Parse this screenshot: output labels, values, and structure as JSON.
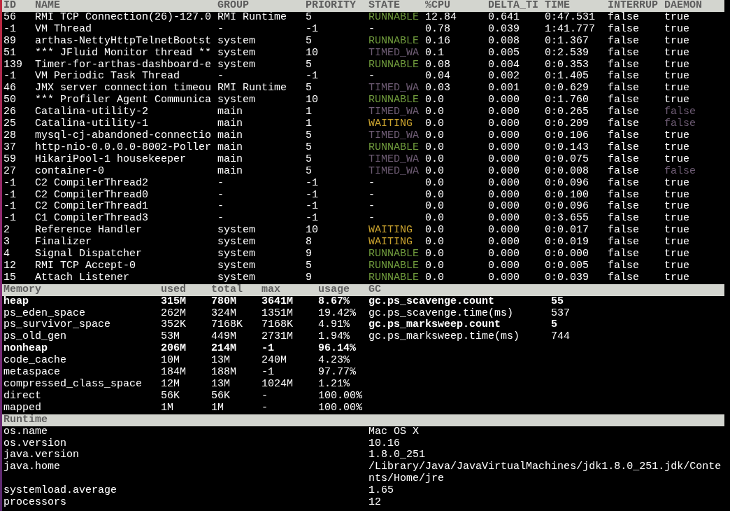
{
  "threads": {
    "columns": [
      "ID",
      "NAME",
      "GROUP",
      "PRIORITY",
      "STATE",
      "%CPU",
      "DELTA_TI",
      "TIME",
      "INTERRUP",
      "DAEMON"
    ],
    "rows": [
      {
        "id": "56",
        "name": "RMI TCP Connection(26)-127.0",
        "group": "RMI Runtime",
        "priority": "5",
        "state": {
          "text": "RUNNABLE",
          "color": "#6f9a3c"
        },
        "cpu": "12.84",
        "delta": "0.641",
        "time": "0:47.531",
        "interrupted": "false",
        "daemon": {
          "text": "true",
          "color": "#ffffff"
        }
      },
      {
        "id": "-1",
        "name": "VM Thread",
        "group": "-",
        "priority": "-1",
        "state": {
          "text": "-",
          "color": "#ffffff"
        },
        "cpu": "0.78",
        "delta": "0.039",
        "time": "1:41.777",
        "interrupted": "false",
        "daemon": {
          "text": "true",
          "color": "#ffffff"
        }
      },
      {
        "id": "89",
        "name": "arthas-NettyHttpTelnetBootst",
        "group": "system",
        "priority": "5",
        "state": {
          "text": "RUNNABLE",
          "color": "#6f9a3c"
        },
        "cpu": "0.16",
        "delta": "0.008",
        "time": "0:1.367",
        "interrupted": "false",
        "daemon": {
          "text": "true",
          "color": "#ffffff"
        }
      },
      {
        "id": "51",
        "name": "*** JFluid Monitor thread **",
        "group": "system",
        "priority": "10",
        "state": {
          "text": "TIMED_WA",
          "color": "#6e5c74"
        },
        "cpu": "0.1",
        "delta": "0.005",
        "time": "0:2.539",
        "interrupted": "false",
        "daemon": {
          "text": "true",
          "color": "#ffffff"
        }
      },
      {
        "id": "139",
        "name": "Timer-for-arthas-dashboard-e",
        "group": "system",
        "priority": "5",
        "state": {
          "text": "RUNNABLE",
          "color": "#6f9a3c"
        },
        "cpu": "0.08",
        "delta": "0.004",
        "time": "0:0.353",
        "interrupted": "false",
        "daemon": {
          "text": "true",
          "color": "#ffffff"
        }
      },
      {
        "id": "-1",
        "name": "VM Periodic Task Thread",
        "group": "-",
        "priority": "-1",
        "state": {
          "text": "-",
          "color": "#ffffff"
        },
        "cpu": "0.04",
        "delta": "0.002",
        "time": "0:1.405",
        "interrupted": "false",
        "daemon": {
          "text": "true",
          "color": "#ffffff"
        }
      },
      {
        "id": "46",
        "name": "JMX server connection timeou",
        "group": "RMI Runtime",
        "priority": "5",
        "state": {
          "text": "TIMED_WA",
          "color": "#6e5c74"
        },
        "cpu": "0.03",
        "delta": "0.001",
        "time": "0:0.629",
        "interrupted": "false",
        "daemon": {
          "text": "true",
          "color": "#ffffff"
        }
      },
      {
        "id": "50",
        "name": "*** Profiler Agent Communica",
        "group": "system",
        "priority": "10",
        "state": {
          "text": "RUNNABLE",
          "color": "#6f9a3c"
        },
        "cpu": "0.0",
        "delta": "0.000",
        "time": "0:1.760",
        "interrupted": "false",
        "daemon": {
          "text": "true",
          "color": "#ffffff"
        }
      },
      {
        "id": "26",
        "name": "Catalina-utility-2",
        "group": "main",
        "priority": "1",
        "state": {
          "text": "TIMED_WA",
          "color": "#6e5c74"
        },
        "cpu": "0.0",
        "delta": "0.000",
        "time": "0:0.265",
        "interrupted": "false",
        "daemon": {
          "text": "false",
          "color": "#6e5c74"
        }
      },
      {
        "id": "25",
        "name": "Catalina-utility-1",
        "group": "main",
        "priority": "1",
        "state": {
          "text": "WAITING",
          "color": "#c9a22e"
        },
        "cpu": "0.0",
        "delta": "0.000",
        "time": "0:0.209",
        "interrupted": "false",
        "daemon": {
          "text": "false",
          "color": "#6e5c74"
        }
      },
      {
        "id": "28",
        "name": "mysql-cj-abandoned-connectio",
        "group": "main",
        "priority": "5",
        "state": {
          "text": "TIMED_WA",
          "color": "#6e5c74"
        },
        "cpu": "0.0",
        "delta": "0.000",
        "time": "0:0.106",
        "interrupted": "false",
        "daemon": {
          "text": "true",
          "color": "#ffffff"
        }
      },
      {
        "id": "37",
        "name": "http-nio-0.0.0.0-8002-Poller",
        "group": "main",
        "priority": "5",
        "state": {
          "text": "RUNNABLE",
          "color": "#6f9a3c"
        },
        "cpu": "0.0",
        "delta": "0.000",
        "time": "0:0.143",
        "interrupted": "false",
        "daemon": {
          "text": "true",
          "color": "#ffffff"
        }
      },
      {
        "id": "59",
        "name": "HikariPool-1 housekeeper",
        "group": "main",
        "priority": "5",
        "state": {
          "text": "TIMED_WA",
          "color": "#6e5c74"
        },
        "cpu": "0.0",
        "delta": "0.000",
        "time": "0:0.075",
        "interrupted": "false",
        "daemon": {
          "text": "true",
          "color": "#ffffff"
        }
      },
      {
        "id": "27",
        "name": "container-0",
        "group": "main",
        "priority": "5",
        "state": {
          "text": "TIMED_WA",
          "color": "#6e5c74"
        },
        "cpu": "0.0",
        "delta": "0.000",
        "time": "0:0.008",
        "interrupted": "false",
        "daemon": {
          "text": "false",
          "color": "#6e5c74"
        }
      },
      {
        "id": "-1",
        "name": "C2 CompilerThread2",
        "group": "-",
        "priority": "-1",
        "state": {
          "text": "-",
          "color": "#ffffff"
        },
        "cpu": "0.0",
        "delta": "0.000",
        "time": "0:0.096",
        "interrupted": "false",
        "daemon": {
          "text": "true",
          "color": "#ffffff"
        }
      },
      {
        "id": "-1",
        "name": "C2 CompilerThread0",
        "group": "-",
        "priority": "-1",
        "state": {
          "text": "-",
          "color": "#ffffff"
        },
        "cpu": "0.0",
        "delta": "0.000",
        "time": "0:0.100",
        "interrupted": "false",
        "daemon": {
          "text": "true",
          "color": "#ffffff"
        }
      },
      {
        "id": "-1",
        "name": "C2 CompilerThread1",
        "group": "-",
        "priority": "-1",
        "state": {
          "text": "-",
          "color": "#ffffff"
        },
        "cpu": "0.0",
        "delta": "0.000",
        "time": "0:0.096",
        "interrupted": "false",
        "daemon": {
          "text": "true",
          "color": "#ffffff"
        }
      },
      {
        "id": "-1",
        "name": "C1 CompilerThread3",
        "group": "-",
        "priority": "-1",
        "state": {
          "text": "-",
          "color": "#ffffff"
        },
        "cpu": "0.0",
        "delta": "0.000",
        "time": "0:3.655",
        "interrupted": "false",
        "daemon": {
          "text": "true",
          "color": "#ffffff"
        }
      },
      {
        "id": "2",
        "name": "Reference Handler",
        "group": "system",
        "priority": "10",
        "state": {
          "text": "WAITING",
          "color": "#c9a22e"
        },
        "cpu": "0.0",
        "delta": "0.000",
        "time": "0:0.017",
        "interrupted": "false",
        "daemon": {
          "text": "true",
          "color": "#ffffff"
        }
      },
      {
        "id": "3",
        "name": "Finalizer",
        "group": "system",
        "priority": "8",
        "state": {
          "text": "WAITING",
          "color": "#c9a22e"
        },
        "cpu": "0.0",
        "delta": "0.000",
        "time": "0:0.019",
        "interrupted": "false",
        "daemon": {
          "text": "true",
          "color": "#ffffff"
        }
      },
      {
        "id": "4",
        "name": "Signal Dispatcher",
        "group": "system",
        "priority": "9",
        "state": {
          "text": "RUNNABLE",
          "color": "#6f9a3c"
        },
        "cpu": "0.0",
        "delta": "0.000",
        "time": "0:0.000",
        "interrupted": "false",
        "daemon": {
          "text": "true",
          "color": "#ffffff"
        }
      },
      {
        "id": "12",
        "name": "RMI TCP Accept-0",
        "group": "system",
        "priority": "5",
        "state": {
          "text": "RUNNABLE",
          "color": "#6f9a3c"
        },
        "cpu": "0.0",
        "delta": "0.000",
        "time": "0:0.005",
        "interrupted": "false",
        "daemon": {
          "text": "true",
          "color": "#ffffff"
        }
      },
      {
        "id": "15",
        "name": "Attach Listener",
        "group": "system",
        "priority": "9",
        "state": {
          "text": "RUNNABLE",
          "color": "#6f9a3c"
        },
        "cpu": "0.0",
        "delta": "0.000",
        "time": "0:0.039",
        "interrupted": "false",
        "daemon": {
          "text": "true",
          "color": "#ffffff"
        }
      }
    ]
  },
  "memory": {
    "columns": [
      "Memory",
      "used",
      "total",
      "max",
      "usage",
      "GC"
    ],
    "rows": [
      {
        "name": "heap",
        "used": "315M",
        "total": "780M",
        "max": "3641M",
        "usage": "8.67%",
        "bold": true
      },
      {
        "name": "ps_eden_space",
        "used": "262M",
        "total": "324M",
        "max": "1351M",
        "usage": "19.42%",
        "bold": false
      },
      {
        "name": "ps_survivor_space",
        "used": "352K",
        "total": "7168K",
        "max": "7168K",
        "usage": "4.91%",
        "bold": false
      },
      {
        "name": "ps_old_gen",
        "used": "53M",
        "total": "449M",
        "max": "2731M",
        "usage": "1.94%",
        "bold": false
      },
      {
        "name": "nonheap",
        "used": "206M",
        "total": "214M",
        "max": "-1",
        "usage": "96.14%",
        "bold": true
      },
      {
        "name": "code_cache",
        "used": "10M",
        "total": "13M",
        "max": "240M",
        "usage": "4.23%",
        "bold": false
      },
      {
        "name": "metaspace",
        "used": "184M",
        "total": "188M",
        "max": "-1",
        "usage": "97.77%",
        "bold": false
      },
      {
        "name": "compressed_class_space",
        "used": "12M",
        "total": "13M",
        "max": "1024M",
        "usage": "1.21%",
        "bold": false
      },
      {
        "name": "direct",
        "used": "56K",
        "total": "56K",
        "max": "-",
        "usage": "100.00%",
        "bold": false
      },
      {
        "name": "mapped",
        "used": "1M",
        "total": "1M",
        "max": "-",
        "usage": "100.00%",
        "bold": false
      }
    ],
    "gc": [
      {
        "name": "gc.ps_scavenge.count",
        "value": "55",
        "bold": true
      },
      {
        "name": "gc.ps_scavenge.time(ms)",
        "value": "537",
        "bold": false
      },
      {
        "name": "gc.ps_marksweep.count",
        "value": "5",
        "bold": true
      },
      {
        "name": "gc.ps_marksweep.time(ms)",
        "value": "744",
        "bold": false
      }
    ]
  },
  "runtime": {
    "title": "Runtime",
    "rows": [
      {
        "name": "os.name",
        "value": "Mac OS X"
      },
      {
        "name": "os.version",
        "value": "10.16"
      },
      {
        "name": "java.version",
        "value": "1.8.0_251"
      },
      {
        "name": "java.home",
        "value": "/Library/Java/JavaVirtualMachines/jdk1.8.0_251.jdk/Contents/Home/jre"
      },
      {
        "name": "systemload.average",
        "value": "1.65"
      },
      {
        "name": "processors",
        "value": "12"
      }
    ]
  }
}
